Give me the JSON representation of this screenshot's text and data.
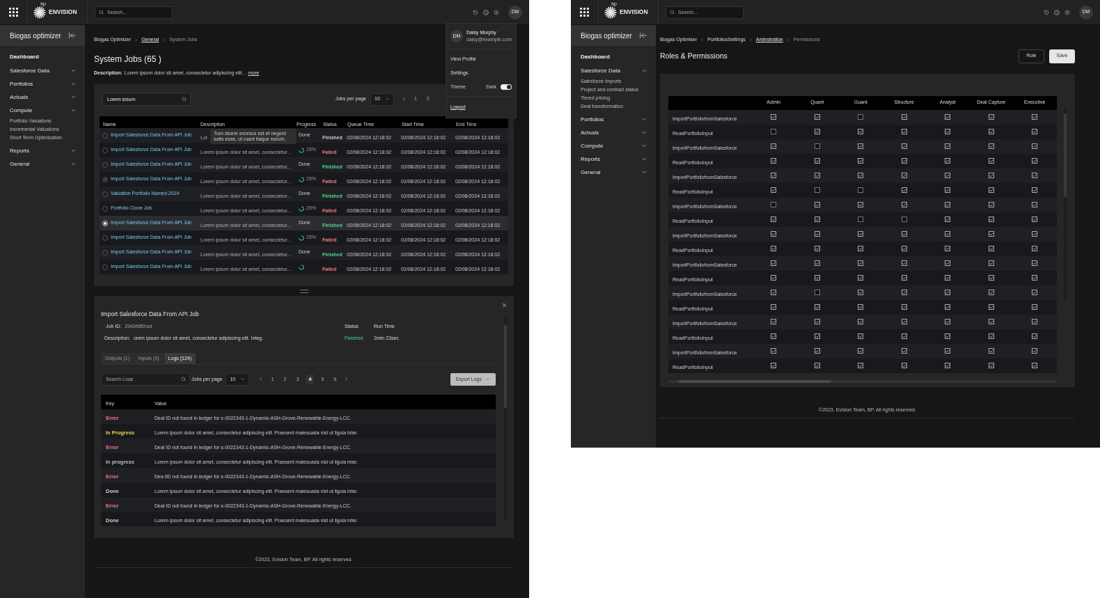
{
  "jobs_screen": {
    "topbar": {
      "brand_mark": "bp",
      "brand": "ENVISION",
      "search_placeholder": "Search...",
      "avatar": "DM"
    },
    "sidebar": {
      "title": "Biogas optimizer",
      "items": [
        {
          "kind": "link",
          "label": "Dashboard"
        },
        {
          "kind": "group",
          "label": "Salesforce Data",
          "expanded": false
        },
        {
          "kind": "group",
          "label": "Portfolios",
          "expanded": false
        },
        {
          "kind": "group",
          "label": "Actuals",
          "expanded": false
        },
        {
          "kind": "group",
          "label": "Compute",
          "expanded": true,
          "children": [
            {
              "label": "Portfolio Valuations"
            },
            {
              "label": "Incremental Valuations"
            },
            {
              "label": "Short Term Optimization"
            }
          ]
        },
        {
          "kind": "group",
          "label": "Reports",
          "expanded": false
        },
        {
          "kind": "group",
          "label": "General",
          "expanded": false
        }
      ]
    },
    "breadcrumbs": [
      {
        "label": "Biogas Optimizer",
        "kind": "plain"
      },
      {
        "label": "General",
        "kind": "link"
      },
      {
        "label": "System Jobs",
        "kind": "current"
      }
    ],
    "title": "System Jobs (65 )",
    "description": {
      "label": "Description:",
      "text": "Lorem ipsum dolor sit amet, consectetur adipiscing elit...",
      "more": "more"
    },
    "filter": {
      "value": "Lorem ipsum"
    },
    "per_page": {
      "label": "Jobs per page",
      "value": "10"
    },
    "pages": [
      {
        "label": "1",
        "selected": false
      },
      {
        "label": "2",
        "selected": false
      }
    ],
    "table": {
      "columns": [
        "Name",
        "Description",
        "Progress",
        "Status",
        "Queue Time",
        "Start Time",
        "End Time"
      ],
      "rows": [
        {
          "name": "Import Salesforce Data From API Job",
          "description": "Lor",
          "progress": {
            "kind": "done",
            "text": "Done"
          },
          "status": {
            "text": "Finished",
            "color": "#c8c8c8"
          },
          "queue": "02/08/2024 12:18:02",
          "start": "02/08/2024 12:18:02",
          "end": "02/08/2024 12:18:02",
          "selected": false,
          "disabled": false
        },
        {
          "name": "Import Salesforce Data From API Job",
          "description": "Lorem ipsum dolor sit amet, consectetur...",
          "progress": {
            "kind": "ring",
            "text": "25%"
          },
          "status": {
            "text": "Failed",
            "color": "#f07a8c"
          },
          "queue": "02/08/2024 12:18:02",
          "start": "02/08/2024 12:18:02",
          "end": "02/08/2024 12:18:02",
          "selected": false,
          "disabled": false
        },
        {
          "name": "Import Salesforce Data From API Job",
          "description": "Lorem ipsum dolor sit amet, consectetur...",
          "progress": {
            "kind": "done",
            "text": "Done"
          },
          "status": {
            "text": "Finished",
            "color": "#4fd68c"
          },
          "queue": "02/08/2024 12:18:02",
          "start": "02/08/2024 12:18:02",
          "end": "02/08/2024 12:18:02",
          "selected": false,
          "disabled": false
        },
        {
          "name": "Import Salesforce Data From API Job",
          "description": "Lorem ipsum dolor sit amet, consectetur...",
          "progress": {
            "kind": "ring",
            "text": "25%"
          },
          "status": {
            "text": "Failed",
            "color": "#f07a8c"
          },
          "queue": "02/08/2024 12:18:02",
          "start": "02/08/2024 12:18:02",
          "end": "02/08/2024 12:18:02",
          "selected": false,
          "disabled": true
        },
        {
          "name": "Valuation Portfolio Named 2024",
          "description": "Lorem ipsum dolor sit amet, consectetur...",
          "progress": {
            "kind": "done",
            "text": "Done"
          },
          "status": {
            "text": "Finished",
            "color": "#4fd68c"
          },
          "queue": "02/08/2024 12:18:02",
          "start": "02/08/2024 12:18:02",
          "end": "02/08/2024 12:18:02",
          "selected": false,
          "disabled": false
        },
        {
          "name": "Portfolio Clone Job",
          "description": "Lorem ipsum dolor sit amet, consectetur...",
          "progress": {
            "kind": "ring",
            "text": "25%"
          },
          "status": {
            "text": "Failed",
            "color": "#f07a8c"
          },
          "queue": "02/08/2024 12:18:02",
          "start": "02/08/2024 12:18:02",
          "end": "02/08/2024 12:18:02",
          "selected": false,
          "disabled": false
        },
        {
          "name": "Import Salesforce Data From API Job",
          "description": "Lorem ipsum dolor sit amet, consectetur...",
          "progress": {
            "kind": "done",
            "text": "Done"
          },
          "status": {
            "text": "Finished",
            "color": "#4fd68c"
          },
          "queue": "02/08/2024 12:18:02",
          "start": "02/08/2024 12:18:02",
          "end": "02/08/2024 12:18:02",
          "selected": true,
          "disabled": false
        },
        {
          "name": "Import Salesforce Data From API Job",
          "description": "Lorem ipsum dolor sit amet, consectetur...",
          "progress": {
            "kind": "ring",
            "text": "25%"
          },
          "status": {
            "text": "Failed",
            "color": "#f07a8c"
          },
          "queue": "02/08/2024 12:18:02",
          "start": "02/08/2024 12:18:02",
          "end": "02/08/2024 12:18:02",
          "selected": false,
          "disabled": false
        },
        {
          "name": "Import Salesforce Data From API Job",
          "description": "Lorem ipsum dolor sit amet, consectetur...",
          "progress": {
            "kind": "done",
            "text": "Done"
          },
          "status": {
            "text": "Finished",
            "color": "#4fd68c"
          },
          "queue": "02/08/2024 12:18:02",
          "start": "02/08/2024 12:18:02",
          "end": "02/08/2024 12:18:02",
          "selected": false,
          "disabled": false
        },
        {
          "name": "Import Salesforce Data From API Job",
          "description": "Lorem ipsum dolor sit amet, consectetur...",
          "progress": {
            "kind": "ring"
          },
          "status": {
            "text": "Failed",
            "color": "#f07a8c"
          },
          "queue": "02/08/2024 12:18:02",
          "start": "02/08/2024 12:18:02",
          "end": "02/08/2024 12:18:02",
          "selected": false,
          "disabled": false
        }
      ]
    },
    "tooltip": "Tum dicere exorsus est et negent satis esse, ut ruant itaque earum.",
    "user_menu": {
      "avatar": "DM",
      "name": "Daisy Murphy",
      "email": "daisy@example.com",
      "items": [
        "View Profile",
        "Settings"
      ],
      "theme": {
        "label": "Theme",
        "value": "Dark",
        "on": true
      },
      "logout": "Logout"
    },
    "details": {
      "title": "Import Salesforce Data From API Job",
      "job_id": {
        "label": "Job ID:",
        "value": "2340fd50rsd"
      },
      "description": {
        "label": "Description:",
        "value": "orem ipsum dolor sit amet, consectetur adipiscing elit. Integ."
      },
      "status": {
        "label": "Status",
        "value": "Finished"
      },
      "run_time": {
        "label": "Run Time",
        "value": "2min 23sec"
      },
      "tabs": [
        {
          "label": "Outputs (1)",
          "selected": false
        },
        {
          "label": "Inputs (9)",
          "selected": false
        },
        {
          "label": "Logs (124)",
          "selected": true
        }
      ],
      "search_placeholder": "Search Logs",
      "per_page": {
        "label": "Jobs per page",
        "value": "10"
      },
      "pages": [
        {
          "label": "1",
          "selected": false
        },
        {
          "label": "2",
          "selected": false
        },
        {
          "label": "3",
          "selected": false
        },
        {
          "label": "4",
          "selected": true
        },
        {
          "label": "5",
          "selected": false
        },
        {
          "label": "6",
          "selected": false
        }
      ],
      "export": "Export Logs",
      "log_columns": [
        "Key",
        "Value"
      ],
      "logs": [
        {
          "key": "Error",
          "color": "#f07a8c",
          "value": "Deal ID not found in ledger for s-0022343-1-Dynamic-ASH-Grove-Renewable-Energy-LCC."
        },
        {
          "key": "In Progress",
          "color": "#e8d45a",
          "value": "Lorem ipsum dolor sit amet, consectetur adipiscing elit. Praesent malesuada nisl ut ligula inter."
        },
        {
          "key": "Error",
          "color": "#f07a8c",
          "value": "Deal ID not found in ledger for s-0022343-1-Dynamic-ASH-Grove-Renewable-Energy-LCC."
        },
        {
          "key": "In progress",
          "color": "#bdbdbd",
          "value": "Lorem ipsum dolor sit amet, consectetur adipiscing elit. Praesent malesuada nisl ut ligula inter."
        },
        {
          "key": "Error",
          "color": "#f07a8c",
          "value": "Dea lID not found in ledger for s-0022343-1-Dynamic-ASH-Grove-Renewable-Energy-LCC."
        },
        {
          "key": "Done",
          "color": "#d0d0d0",
          "value": "Lorem ipsum dolor sit amet, consectetur adipiscing elit. Praesent malesuada nisl ut ligula inter."
        },
        {
          "key": "Error",
          "color": "#f07a8c",
          "value": "Deal ID not found in ledger for s-0022343-1-Dynamic-ASH-Grove-Renewable-Energy-LCC."
        },
        {
          "key": "Done",
          "color": "#d0d0d0",
          "value": "Lorem ipsum dolor sit amet, consectetur adipiscing elit. Praesent malesuada nisl ut ligula inter."
        }
      ]
    },
    "footer": "©2023, Evision Team, BP. All rights reserved."
  },
  "permissions_screen": {
    "topbar": {
      "brand_mark": "bp",
      "brand": "ENVISION",
      "search_placeholder": "Search...",
      "avatar": "DM"
    },
    "sidebar": {
      "title": "Biogas optimizer",
      "items": [
        {
          "kind": "link",
          "label": "Dashboard"
        },
        {
          "kind": "group",
          "label": "Salesforce Data",
          "expanded": true,
          "children": [
            {
              "label": "Salesforce Imports"
            },
            {
              "label": "Project and contract status"
            },
            {
              "label": "Tiered pricing"
            },
            {
              "label": "Deal transformation"
            }
          ]
        },
        {
          "kind": "group",
          "label": "Portfolios",
          "expanded": false
        },
        {
          "kind": "group",
          "label": "Actuals",
          "expanded": false
        },
        {
          "kind": "group",
          "label": "Compute",
          "expanded": false
        },
        {
          "kind": "group",
          "label": "Reports",
          "expanded": false
        },
        {
          "kind": "group",
          "label": "General",
          "expanded": false
        }
      ]
    },
    "breadcrumbs": [
      {
        "label": "Biogas Optimiser",
        "kind": "plain"
      },
      {
        "label": "PortfoliosSettings",
        "kind": "plain"
      },
      {
        "label": "Aminstration",
        "kind": "link"
      },
      {
        "label": "Permissions",
        "kind": "current"
      }
    ],
    "title": "Roles & Permissions",
    "buttons": [
      {
        "label": "Role",
        "kind": "outline"
      },
      {
        "label": "Save",
        "kind": "primary"
      }
    ],
    "table": {
      "columns": [
        "Admin",
        "Quant",
        "Guant",
        "Structure",
        "Analyst",
        "Deal Capture",
        "Executive"
      ],
      "rows": [
        {
          "name": "ImportPortfoliofromSalesforce",
          "cells": [
            {
              "checked": true
            },
            {
              "checked": true
            },
            {
              "checked": false
            },
            {
              "checked": true
            },
            {
              "checked": true
            },
            {
              "checked": true
            },
            {
              "checked": true
            }
          ]
        },
        {
          "name": "ReadPortfolioInput",
          "cells": [
            {
              "checked": false
            },
            {
              "checked": true
            },
            {
              "checked": true
            },
            {
              "checked": true
            },
            {
              "checked": true
            },
            {
              "checked": true
            },
            {
              "checked": true
            }
          ]
        },
        {
          "name": "ImportPortfoliofromSalesforce",
          "cells": [
            {
              "checked": true
            },
            {
              "checked": false
            },
            {
              "checked": true
            },
            {
              "checked": true
            },
            {
              "checked": true
            },
            {
              "checked": true
            },
            {
              "checked": true
            }
          ]
        },
        {
          "name": "ReadPortfolioInput",
          "cells": [
            {
              "checked": true
            },
            {
              "checked": true
            },
            {
              "checked": true
            },
            {
              "checked": true
            },
            {
              "checked": true
            },
            {
              "checked": true
            },
            {
              "checked": true
            }
          ]
        },
        {
          "name": "ImportPortfoliofromSalesforce",
          "cells": [
            {
              "checked": true
            },
            {
              "checked": true
            },
            {
              "checked": true
            },
            {
              "checked": true
            },
            {
              "checked": true
            },
            {
              "checked": true
            },
            {
              "checked": true
            }
          ]
        },
        {
          "name": "ReadPortfolioInput",
          "cells": [
            {
              "checked": true
            },
            {
              "checked": false
            },
            {
              "checked": false
            },
            {
              "checked": true
            },
            {
              "checked": true
            },
            {
              "checked": true
            },
            {
              "checked": true
            }
          ]
        },
        {
          "name": "ImportPortfoliofromSalesforce",
          "cells": [
            {
              "checked": false
            },
            {
              "checked": true
            },
            {
              "checked": true
            },
            {
              "checked": true
            },
            {
              "checked": true
            },
            {
              "checked": true
            },
            {
              "checked": true
            }
          ]
        },
        {
          "name": "ReadPortfolioInput",
          "cells": [
            {
              "checked": true
            },
            {
              "checked": true
            },
            {
              "checked": false
            },
            {
              "checked": false
            },
            {
              "checked": true
            },
            {
              "checked": true
            },
            {
              "checked": true
            }
          ]
        },
        {
          "name": "ImportPortfoliofromSalesforce",
          "cells": [
            {
              "checked": true
            },
            {
              "checked": true
            },
            {
              "checked": true
            },
            {
              "checked": true
            },
            {
              "checked": true
            },
            {
              "checked": true
            },
            {
              "checked": true
            }
          ]
        },
        {
          "name": "ReadPortfolioInput",
          "cells": [
            {
              "checked": true
            },
            {
              "checked": true
            },
            {
              "checked": true
            },
            {
              "checked": true
            },
            {
              "checked": true
            },
            {
              "checked": true
            },
            {
              "checked": true
            }
          ]
        },
        {
          "name": "ImportPortfoliofromSalesforce",
          "cells": [
            {
              "checked": true
            },
            {
              "checked": true
            },
            {
              "checked": true
            },
            {
              "checked": true
            },
            {
              "checked": true
            },
            {
              "checked": true
            },
            {
              "checked": true
            }
          ]
        },
        {
          "name": "ReadPortfolioInput",
          "cells": [
            {
              "checked": true
            },
            {
              "checked": true
            },
            {
              "checked": true
            },
            {
              "checked": true
            },
            {
              "checked": true
            },
            {
              "checked": true
            },
            {
              "checked": true
            }
          ]
        },
        {
          "name": "ImportPortfoliofromSalesforce",
          "cells": [
            {
              "checked": true
            },
            {
              "checked": false
            },
            {
              "checked": true
            },
            {
              "checked": true
            },
            {
              "checked": true
            },
            {
              "checked": true
            },
            {
              "checked": true
            }
          ]
        },
        {
          "name": "ReadPortfolioInput",
          "cells": [
            {
              "checked": true
            },
            {
              "checked": true
            },
            {
              "checked": true
            },
            {
              "checked": true
            },
            {
              "checked": true
            },
            {
              "checked": true
            },
            {
              "checked": true
            }
          ]
        },
        {
          "name": "ImportPortfoliofromSalesforce",
          "cells": [
            {
              "checked": true
            },
            {
              "checked": true
            },
            {
              "checked": true
            },
            {
              "checked": true
            },
            {
              "checked": true
            },
            {
              "checked": true
            },
            {
              "checked": true
            }
          ]
        },
        {
          "name": "ReadPortfolioInput",
          "cells": [
            {
              "checked": true
            },
            {
              "checked": true
            },
            {
              "checked": true
            },
            {
              "checked": true
            },
            {
              "checked": true
            },
            {
              "checked": true
            },
            {
              "checked": true
            }
          ]
        },
        {
          "name": "ImportPortfoliofromSalesforce",
          "cells": [
            {
              "checked": true
            },
            {
              "checked": true
            },
            {
              "checked": true
            },
            {
              "checked": true
            },
            {
              "checked": true
            },
            {
              "checked": true
            },
            {
              "checked": true
            }
          ]
        },
        {
          "name": "ReadPortfolioInput",
          "cells": [
            {
              "checked": true
            },
            {
              "checked": true
            },
            {
              "checked": true
            },
            {
              "checked": true
            },
            {
              "checked": true
            },
            {
              "checked": true
            },
            {
              "checked": true
            }
          ]
        }
      ]
    },
    "footer": "©2023, Evision Team, BP. All rights reserved."
  }
}
